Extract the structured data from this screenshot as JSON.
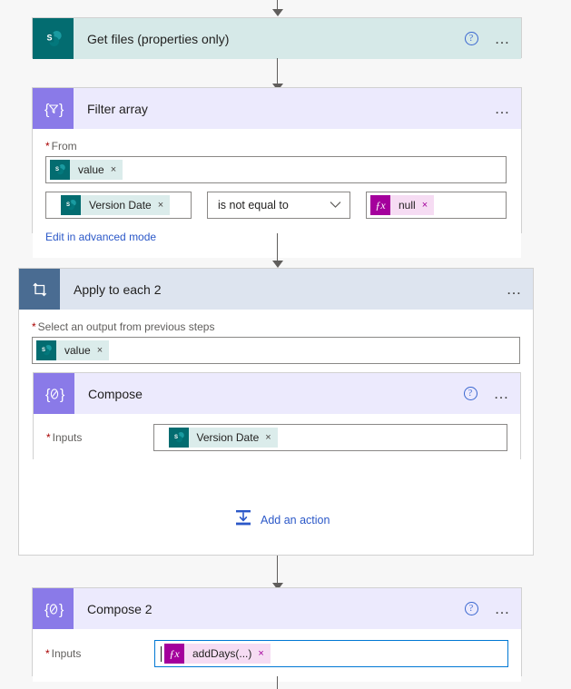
{
  "app": {
    "name": "power-automate-flow-designer"
  },
  "steps": [
    {
      "id": "get-files",
      "title": "Get files (properties only)",
      "icon": "sharepoint-icon",
      "help_label": "?",
      "menu_label": "…"
    },
    {
      "id": "filter-array",
      "title": "Filter array",
      "icon": "filter-array-icon",
      "menu_label": "…",
      "from_label": "From",
      "required_marker": "*",
      "from_token": {
        "type": "sharepoint",
        "text": "value",
        "remove": "×"
      },
      "condition": {
        "left_token": {
          "type": "sharepoint",
          "text": "Version Date",
          "remove": "×"
        },
        "operator": "is not equal to",
        "operator_chevron": "⌄",
        "right_token": {
          "type": "expression",
          "icon_label": "ƒx",
          "text": "null",
          "remove": "×"
        }
      },
      "advanced_link": "Edit in advanced mode"
    },
    {
      "id": "apply-to-each-2",
      "title": "Apply to each 2",
      "icon": "loop-icon",
      "menu_label": "…",
      "output_label": "Select an output from previous steps",
      "required_marker": "*",
      "output_token": {
        "type": "sharepoint",
        "text": "value",
        "remove": "×"
      },
      "child": {
        "id": "compose",
        "title": "Compose",
        "icon": "compose-icon",
        "help_label": "?",
        "menu_label": "…",
        "inputs_label": "Inputs",
        "required_marker": "*",
        "inputs_token": {
          "type": "sharepoint",
          "text": "Version Date",
          "remove": "×"
        }
      },
      "add_action": {
        "label": "Add an action",
        "icon": "insert-action-icon"
      }
    },
    {
      "id": "compose-2",
      "title": "Compose 2",
      "icon": "compose-icon",
      "help_label": "?",
      "menu_label": "…",
      "inputs_label": "Inputs",
      "required_marker": "*",
      "inputs_token": {
        "type": "expression",
        "icon_label": "ƒx",
        "text": "addDays(...)",
        "remove": "×"
      },
      "focused": true
    }
  ],
  "colors": {
    "sharepoint_teal": "#036c70",
    "sharepoint_header": "#d6e9e8",
    "control_purple": "#8a7ae8",
    "control_header": "#eceafd",
    "loop_blue": "#4a6c92",
    "loop_header": "#dde4ef",
    "expression_magenta": "#a4009c",
    "link_blue": "#2b58c8",
    "focus_blue": "#0078d4",
    "required_red": "#a80000",
    "canvas_bg": "#f7f7f7"
  }
}
